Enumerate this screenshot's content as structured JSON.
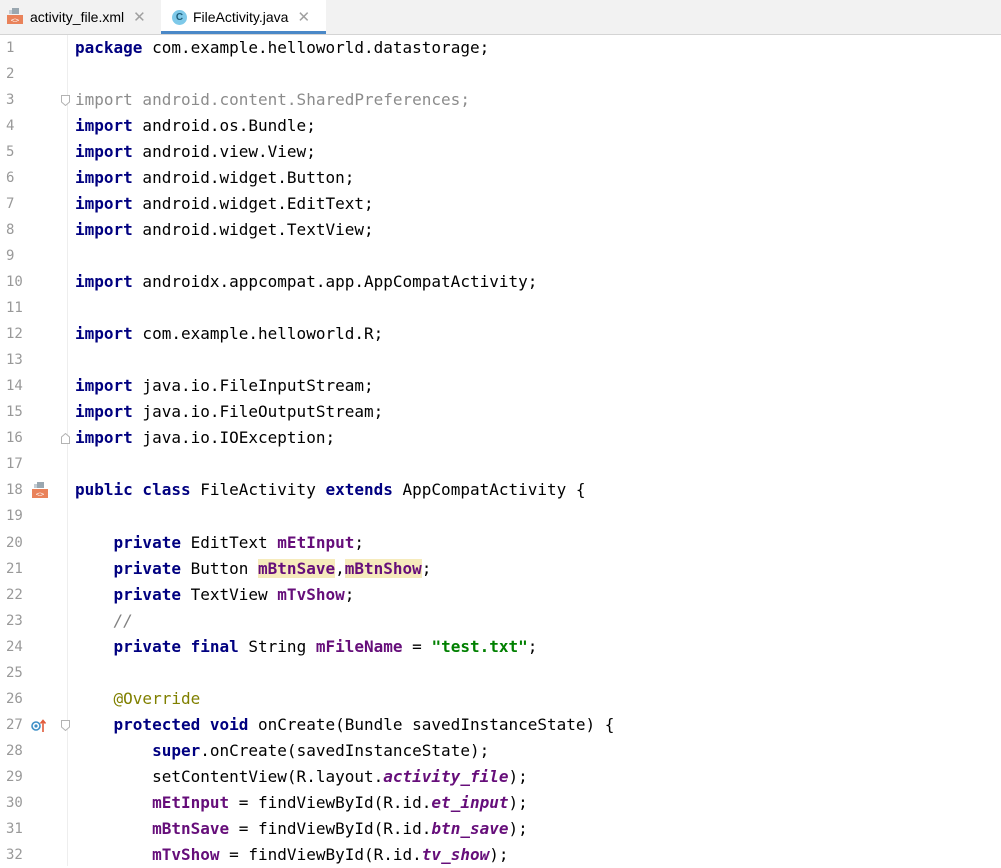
{
  "tabs": [
    {
      "label": "activity_file.xml",
      "icon": "xml-layout-icon",
      "close": "✕"
    },
    {
      "label": "FileActivity.java",
      "icon": "java-class-icon",
      "close": "✕",
      "active": true
    }
  ],
  "lines": {
    "l1": {
      "n": "1",
      "t0": "package",
      "t1": " com.example.helloworld.datastorage;"
    },
    "l2": {
      "n": "2"
    },
    "l3": {
      "n": "3",
      "t0": "import",
      "t1": " android.content.SharedPreferences;"
    },
    "l4": {
      "n": "4",
      "t0": "import",
      "t1": " android.os.Bundle;"
    },
    "l5": {
      "n": "5",
      "t0": "import",
      "t1": " android.view.View;"
    },
    "l6": {
      "n": "6",
      "t0": "import",
      "t1": " android.widget.Button;"
    },
    "l7": {
      "n": "7",
      "t0": "import",
      "t1": " android.widget.EditText;"
    },
    "l8": {
      "n": "8",
      "t0": "import",
      "t1": " android.widget.TextView;"
    },
    "l9": {
      "n": "9"
    },
    "l10": {
      "n": "10",
      "t0": "import",
      "t1": " androidx.appcompat.app.AppCompatActivity;"
    },
    "l11": {
      "n": "11"
    },
    "l12": {
      "n": "12",
      "t0": "import",
      "t1": " com.example.helloworld.R;"
    },
    "l13": {
      "n": "13"
    },
    "l14": {
      "n": "14",
      "t0": "import",
      "t1": " java.io.FileInputStream;"
    },
    "l15": {
      "n": "15",
      "t0": "import",
      "t1": " java.io.FileOutputStream;"
    },
    "l16": {
      "n": "16",
      "t0": "import",
      "t1": " java.io.IOException;"
    },
    "l17": {
      "n": "17"
    },
    "l18": {
      "n": "18",
      "t0": "public class",
      "t1": " FileActivity ",
      "t2": "extends",
      "t3": " AppCompatActivity {"
    },
    "l19": {
      "n": "19"
    },
    "l20": {
      "n": "20",
      "t0": "    private",
      "t1": " EditText ",
      "t2": "mEtInput",
      "t3": ";"
    },
    "l21": {
      "n": "21",
      "t0": "    private",
      "t1": " Button ",
      "t2": "mBtnSave",
      "t3": ",",
      "t4": "mBtnShow",
      "t5": ";"
    },
    "l22": {
      "n": "22",
      "t0": "    private",
      "t1": " TextView ",
      "t2": "mTvShow",
      "t3": ";"
    },
    "l23": {
      "n": "23",
      "t0": "    //"
    },
    "l24": {
      "n": "24",
      "t0": "    private final",
      "t1": " String ",
      "t2": "mFileName",
      "t3": " = ",
      "t4": "\"test.txt\"",
      "t5": ";"
    },
    "l25": {
      "n": "25"
    },
    "l26": {
      "n": "26",
      "t0": "    @Override"
    },
    "l27": {
      "n": "27",
      "t0": "    protected void",
      "t1": " onCreate(Bundle savedInstanceState) {"
    },
    "l28": {
      "n": "28",
      "t0": "        super",
      "t1": ".onCreate(savedInstanceState);"
    },
    "l29": {
      "n": "29",
      "t0": "        setContentView(R.layout.",
      "t1": "activity_file",
      "t2": ");"
    },
    "l30": {
      "n": "30",
      "t0": "        ",
      "t1": "mEtInput",
      "t2": " = findViewById(R.id.",
      "t3": "et_input",
      "t4": ");"
    },
    "l31": {
      "n": "31",
      "t0": "        ",
      "t1": "mBtnSave",
      "t2": " = findViewById(R.id.",
      "t3": "btn_save",
      "t4": ");"
    },
    "l32": {
      "n": "32",
      "t0": "        ",
      "t1": "mTvShow",
      "t2": " = findViewById(R.id.",
      "t3": "tv_show",
      "t4": ");"
    }
  },
  "colors": {
    "keyword": "#000080",
    "field": "#660e7a",
    "string": "#008000",
    "annotation": "#808000",
    "comment": "#808080",
    "highlight": "#f6ebbc",
    "tab_accent": "#4a88c7"
  }
}
